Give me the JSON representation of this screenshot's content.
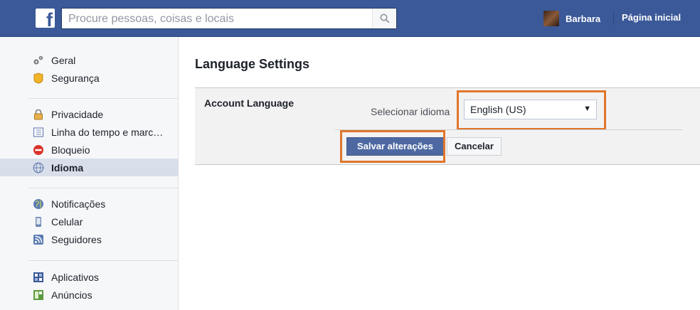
{
  "header": {
    "search_placeholder": "Procure pessoas, coisas e locais",
    "user_name": "Barbara",
    "home_link": "Página inicial"
  },
  "sidebar": {
    "groups": [
      {
        "items": [
          {
            "label": "Geral",
            "icon": "gears-icon"
          },
          {
            "label": "Segurança",
            "icon": "security-badge-icon"
          }
        ]
      },
      {
        "items": [
          {
            "label": "Privacidade",
            "icon": "lock-icon"
          },
          {
            "label": "Linha do tempo e marc…",
            "icon": "timeline-icon"
          },
          {
            "label": "Bloqueio",
            "icon": "block-icon"
          },
          {
            "label": "Idioma",
            "icon": "globe-icon",
            "active": true
          }
        ]
      },
      {
        "items": [
          {
            "label": "Notificações",
            "icon": "globe-notifications-icon"
          },
          {
            "label": "Celular",
            "icon": "mobile-phone-icon"
          },
          {
            "label": "Seguidores",
            "icon": "rss-icon"
          }
        ]
      },
      {
        "items": [
          {
            "label": "Aplicativos",
            "icon": "apps-icon"
          },
          {
            "label": "Anúncios",
            "icon": "ads-icon"
          }
        ]
      }
    ]
  },
  "main": {
    "title": "Language Settings",
    "account_language_label": "Account Language",
    "select_label": "Selecionar idioma",
    "selected_language": "English (US)",
    "save_button": "Salvar alterações",
    "cancel_button": "Cancelar"
  },
  "colors": {
    "brand": "#3b5998",
    "highlight": "#e0762c",
    "primary_button": "#4e69a2"
  }
}
